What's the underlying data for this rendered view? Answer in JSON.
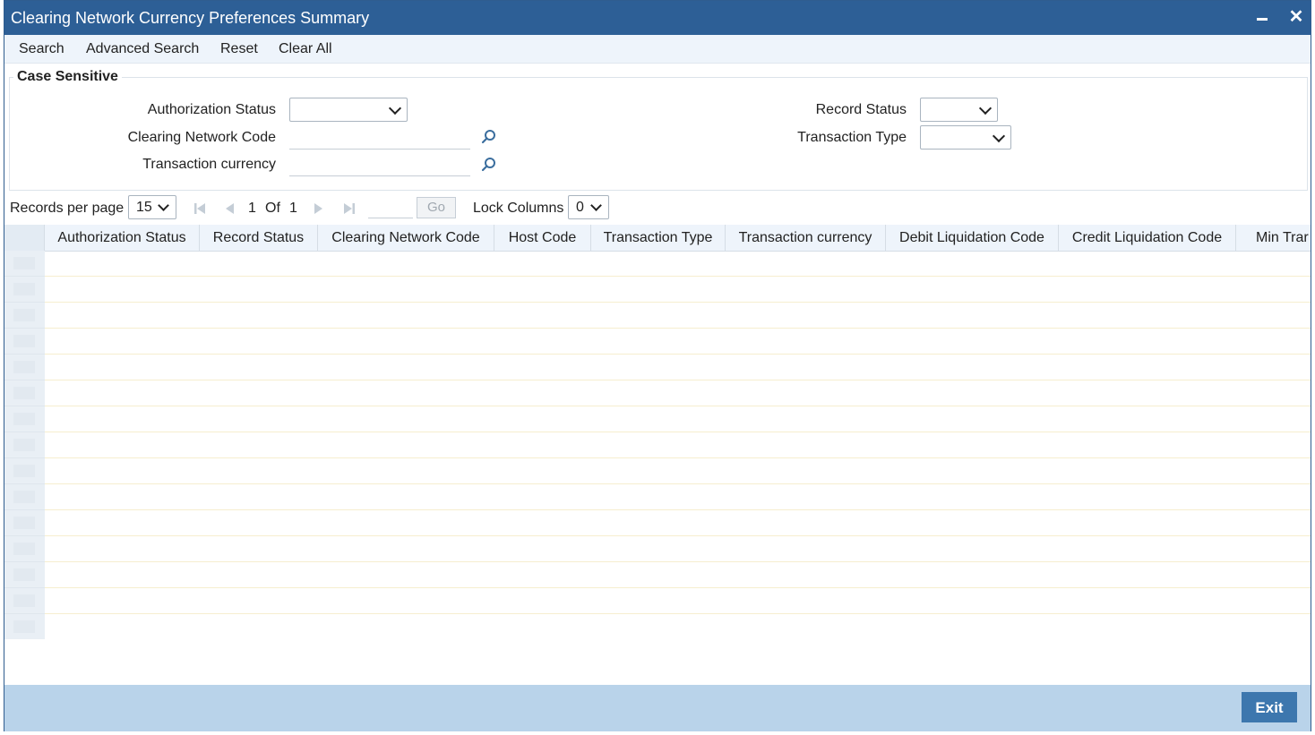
{
  "window": {
    "title": "Clearing Network Currency Preferences Summary"
  },
  "toolbar": {
    "search": "Search",
    "advanced_search": "Advanced Search",
    "reset": "Reset",
    "clear_all": "Clear All"
  },
  "criteria": {
    "legend": "Case Sensitive",
    "authorization_status_label": "Authorization Status",
    "authorization_status_value": "",
    "clearing_network_code_label": "Clearing Network Code",
    "clearing_network_code_value": "",
    "transaction_currency_label": "Transaction currency",
    "transaction_currency_value": "",
    "record_status_label": "Record Status",
    "record_status_value": "",
    "transaction_type_label": "Transaction Type",
    "transaction_type_value": ""
  },
  "pager": {
    "records_per_page_label": "Records per page",
    "records_per_page_value": "15",
    "current_page": "1",
    "of_label": "Of",
    "total_pages": "1",
    "go_label": "Go",
    "lock_columns_label": "Lock Columns",
    "lock_columns_value": "0"
  },
  "grid": {
    "columns": [
      "Authorization Status",
      "Record Status",
      "Clearing Network Code",
      "Host Code",
      "Transaction Type",
      "Transaction currency",
      "Debit Liquidation Code",
      "Credit Liquidation Code",
      "Min Trar"
    ],
    "row_count": 15
  },
  "footer": {
    "exit_label": "Exit"
  },
  "colors": {
    "titlebar": "#2d5f96",
    "footer": "#b9d3ea",
    "exit_button": "#3d77ae"
  }
}
